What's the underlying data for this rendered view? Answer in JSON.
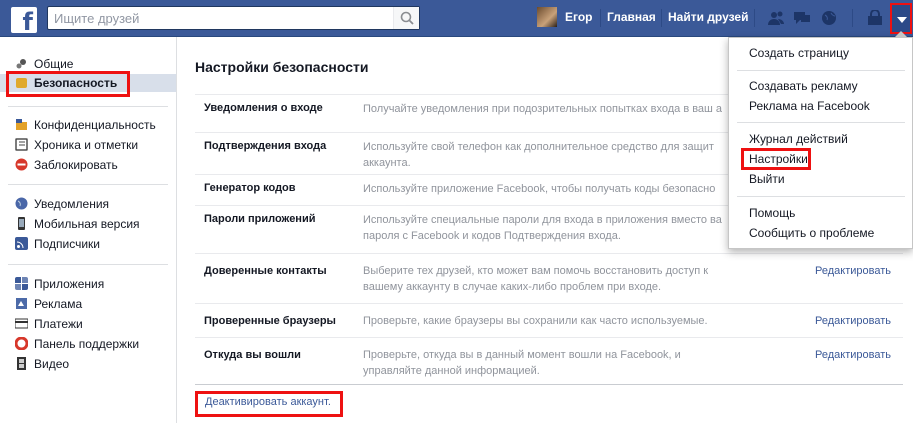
{
  "topbar": {
    "logo": "f",
    "search_placeholder": "Ищите друзей",
    "user": "Егор",
    "home": "Главная",
    "find_friends": "Найти друзей"
  },
  "sidebar": {
    "items": [
      {
        "label": "Общие",
        "icon": "gear-icon"
      },
      {
        "label": "Безопасность",
        "icon": "shield-icon"
      },
      {
        "label": "Конфиденциальность",
        "icon": "lock-icon"
      },
      {
        "label": "Хроника и отметки",
        "icon": "timeline-icon"
      },
      {
        "label": "Заблокировать",
        "icon": "block-icon"
      },
      {
        "label": "Уведомления",
        "icon": "globe-icon"
      },
      {
        "label": "Мобильная версия",
        "icon": "mobile-icon"
      },
      {
        "label": "Подписчики",
        "icon": "rss-icon"
      },
      {
        "label": "Приложения",
        "icon": "apps-icon"
      },
      {
        "label": "Реклама",
        "icon": "ads-icon"
      },
      {
        "label": "Платежи",
        "icon": "card-icon"
      },
      {
        "label": "Панель поддержки",
        "icon": "lifebuoy-icon"
      },
      {
        "label": "Видео",
        "icon": "film-icon"
      }
    ]
  },
  "main": {
    "title": "Настройки безопасности",
    "rows": [
      {
        "label": "Уведомления о входе",
        "desc": "Получайте уведомления при подозрительных попытках входа в ваш а",
        "edit": ""
      },
      {
        "label": "Подтверждения входа",
        "desc": "Используйте свой телефон как дополнительное средство для защит аккаунта.",
        "edit": ""
      },
      {
        "label": "Генератор кодов",
        "desc": "Используйте приложение Facebook, чтобы получать коды безопасно",
        "edit": ""
      },
      {
        "label": "Пароли приложений",
        "desc": "Используйте специальные пароли для входа в приложения вместо ва пароля с Facebook и кодов Подтверждения входа.",
        "edit": ""
      },
      {
        "label": "Доверенные контакты",
        "desc": "Выберите тех друзей, кто может вам помочь восстановить доступ к вашему аккаунту в случае каких-либо проблем при входе.",
        "edit": "Редактировать"
      },
      {
        "label": "Проверенные браузеры",
        "desc": "Проверьте, какие браузеры вы сохранили как часто используемые.",
        "edit": "Редактировать"
      },
      {
        "label": "Откуда вы вошли",
        "desc": "Проверьте, откуда вы в данный момент вошли на Facebook, и управляйте данной информацией.",
        "edit": "Редактировать"
      }
    ],
    "deactivate": "Деактивировать аккаунт."
  },
  "menu": {
    "items": [
      "Создать страницу",
      "Создавать рекламу",
      "Реклама на Facebook",
      "Журнал действий",
      "Настройки",
      "Выйти",
      "Помощь",
      "Сообщить о проблеме"
    ]
  },
  "colors": {
    "brand": "#3b5998",
    "highlight": "#ee1111"
  }
}
